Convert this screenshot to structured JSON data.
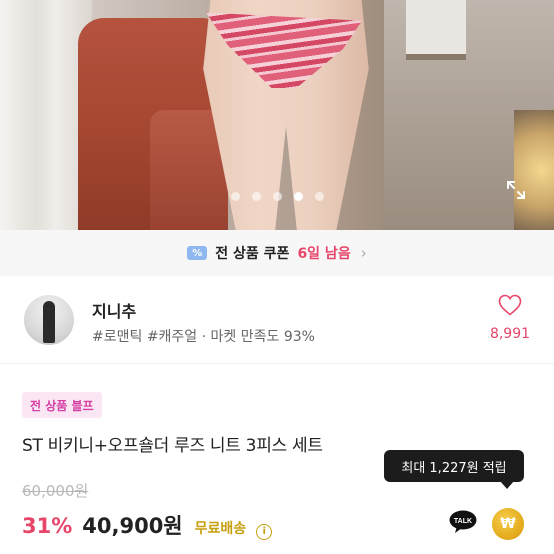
{
  "gallery": {
    "slide_count": 5,
    "active_index": 3
  },
  "coupon": {
    "icon_text": "%",
    "label": "전 상품 쿠폰",
    "days_left": "6일 남음",
    "chevron": "›"
  },
  "shop": {
    "name": "지니추",
    "tags": "#로맨틱 #캐주얼 · 마켓 만족도 93%",
    "like_count": "8,991"
  },
  "product": {
    "badge": "전 상품 블프",
    "title": "ST 비키니+오프숄더 루즈 니트 3피스 세트",
    "original_price": "60,000원",
    "discount": "31%",
    "price": "40,900원",
    "shipping": "무료배송",
    "info_icon_text": "i",
    "points_tooltip": "최대 1,227원 적립",
    "talk_label": "TALK",
    "won_symbol": "₩"
  },
  "colors": {
    "accent_pink": "#e8456a",
    "badge_pink": "#d43fa4",
    "shipping_gold": "#c7a012",
    "coupon_bg": "#f7f7f8"
  },
  "icons": [
    "expand-icon",
    "coupon-icon",
    "chevron-right-icon",
    "heart-icon",
    "info-icon",
    "kakao-talk-icon",
    "won-coin-icon"
  ]
}
